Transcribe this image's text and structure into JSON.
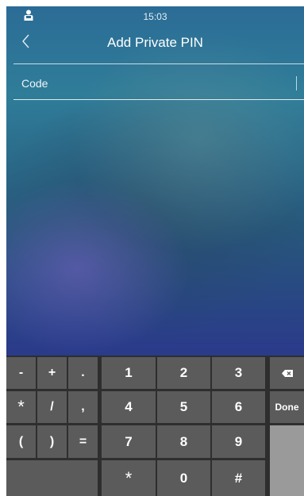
{
  "status_bar": {
    "time": "15:03",
    "user_icon": "person-badge-icon"
  },
  "header": {
    "title": "Add Private PIN",
    "back_icon": "chevron-left-icon"
  },
  "form": {
    "code_label": "Code"
  },
  "keyboard": {
    "symbols": [
      [
        "-",
        "+",
        "."
      ],
      [
        "*",
        "/",
        ","
      ],
      [
        "(",
        ")",
        "="
      ]
    ],
    "numbers": [
      [
        "1",
        "2",
        "3"
      ],
      [
        "4",
        "5",
        "6"
      ],
      [
        "7",
        "8",
        "9"
      ],
      [
        "*",
        "0",
        "#"
      ]
    ],
    "backspace_icon": "backspace-icon",
    "done_label": "Done"
  },
  "colors": {
    "key": "#5b5b5b",
    "keyboard_bg": "#2e2e2e",
    "filler_key": "#9a9a9a",
    "text": "#ffffff"
  }
}
